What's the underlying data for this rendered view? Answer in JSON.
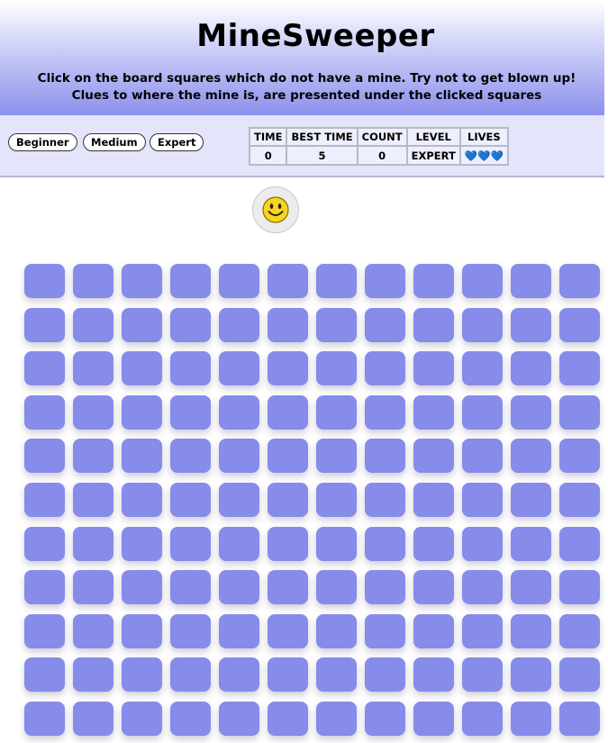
{
  "header": {
    "title": "MineSweeper",
    "instructions_line1": "Click on the board squares which do not have a mine. Try not to get blown up!",
    "instructions_line2": "Clues to where the mine is, are presented under the clicked squares"
  },
  "controls": {
    "levels": [
      "Beginner",
      "Medium",
      "Expert"
    ]
  },
  "stats": {
    "headers": [
      "TIME",
      "BEST TIME",
      "COUNT",
      "LEVEL",
      "LIVES"
    ],
    "time": "0",
    "best_time": "5",
    "count": "0",
    "level": "EXPERT",
    "lives": "💙💙💙"
  },
  "smiley": {
    "icon": "smiley-face-icon"
  },
  "board": {
    "visible_columns": 12,
    "visible_rows": 11,
    "cell_color": "#878be9"
  },
  "colors": {
    "header_gradient_start": "#ffffff",
    "header_gradient_end": "#8c90ec",
    "controls_background": "#e4e5fa",
    "cell": "#878be9",
    "life_heart": "#1e88e5"
  }
}
